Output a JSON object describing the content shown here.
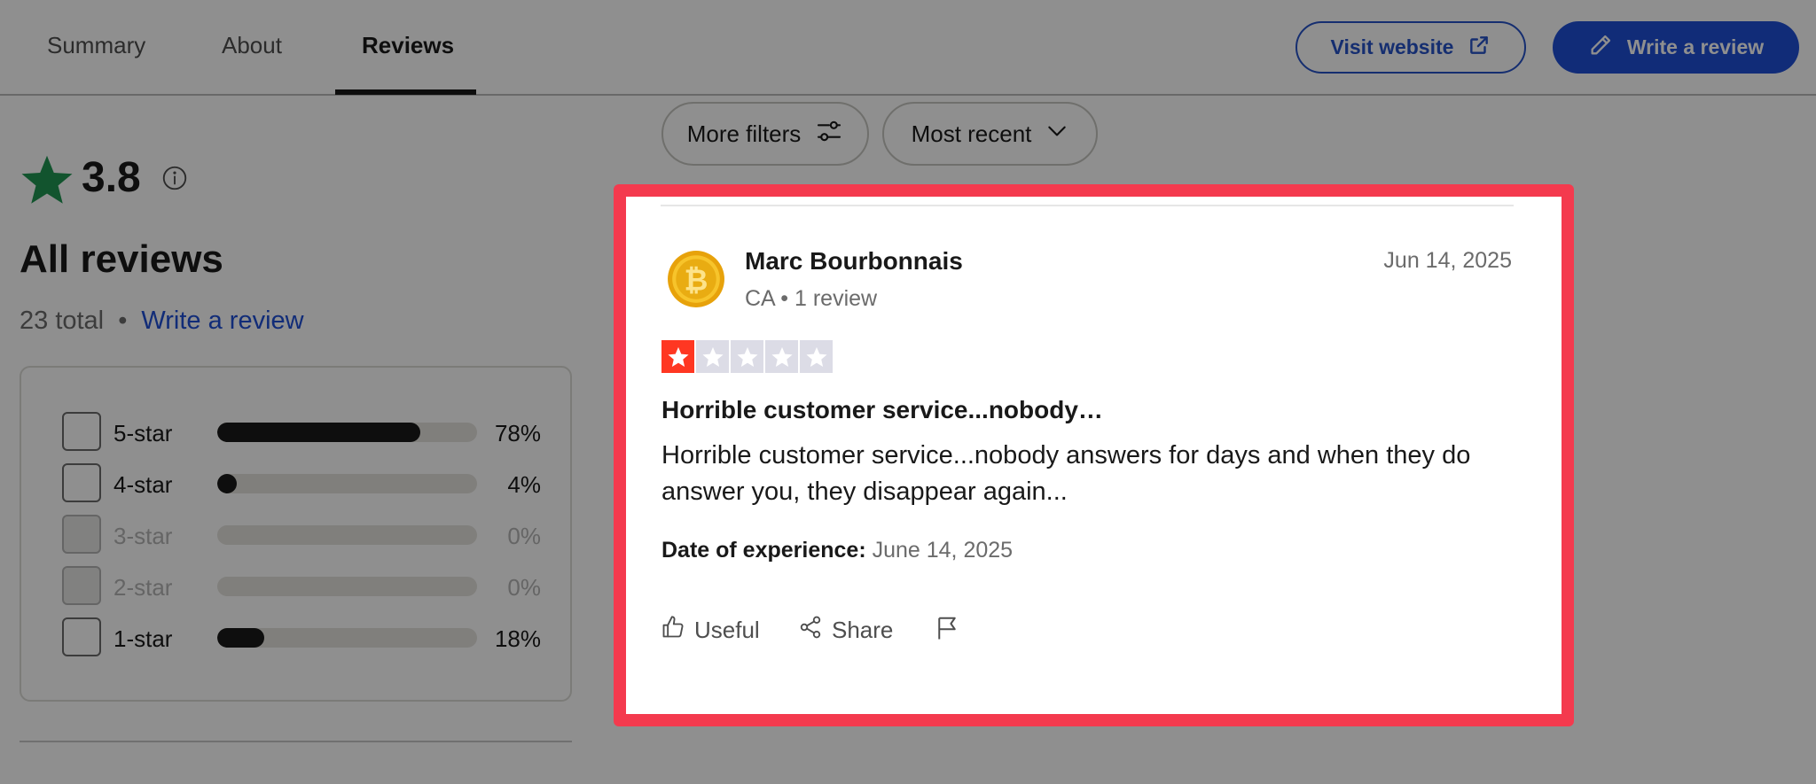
{
  "header": {
    "tabs": [
      {
        "label": "Summary"
      },
      {
        "label": "About"
      },
      {
        "label": "Reviews",
        "active": true
      }
    ],
    "visit_website_label": "Visit website",
    "write_review_label": "Write a review",
    "accent_color": "#1f4fd6"
  },
  "summary": {
    "rating": "3.8",
    "heading": "All reviews",
    "total": "23 total",
    "separator": "•",
    "write_review_link": "Write a review",
    "distribution": [
      {
        "label": "5-star",
        "percent": "78%",
        "fraction": 0.78,
        "enabled": true
      },
      {
        "label": "4-star",
        "percent": "4%",
        "fraction": 0.04,
        "enabled": true
      },
      {
        "label": "3-star",
        "percent": "0%",
        "fraction": 0,
        "enabled": false
      },
      {
        "label": "2-star",
        "percent": "0%",
        "fraction": 0,
        "enabled": false
      },
      {
        "label": "1-star",
        "percent": "18%",
        "fraction": 0.18,
        "enabled": true
      }
    ]
  },
  "filters": {
    "more_filters_label": "More filters",
    "sort_label": "Most recent"
  },
  "review": {
    "reviewer_name": "Marc Bourbonnais",
    "reviewer_meta": "CA • 1 review",
    "date": "Jun 14, 2025",
    "stars_filled": 1,
    "stars_total": 5,
    "star_color": "#ff3722",
    "title": "Horrible customer service...nobody…",
    "body": "Horrible customer service...nobody answers for days and when they do answer you, they disappear again...",
    "experience_label": "Date of experience:",
    "experience_date": "June 14, 2025",
    "actions": {
      "useful_label": "Useful",
      "share_label": "Share"
    },
    "highlight_color": "#f43a4e"
  }
}
